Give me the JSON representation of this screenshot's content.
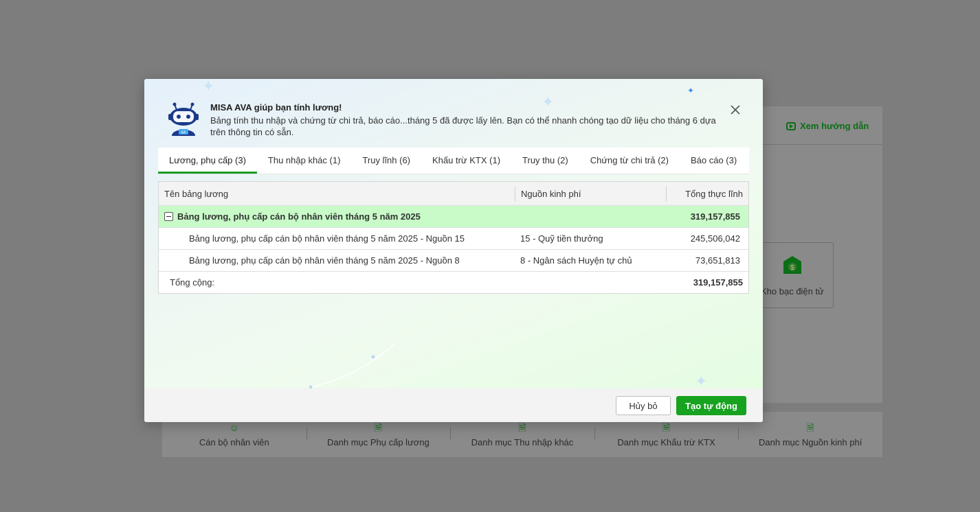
{
  "background": {
    "guide_link": "Xem hướng dẫn",
    "card_label": "Kho bạc điện tử",
    "bottom_items": [
      {
        "label": "Cán bộ nhân viên",
        "icon": "users-icon"
      },
      {
        "label": "Danh mục Phụ cấp lương",
        "icon": "allowance-doc-icon"
      },
      {
        "label": "Danh mục Thu nhập khác",
        "icon": "income-doc-icon"
      },
      {
        "label": "Danh mục Khấu trừ KTX",
        "icon": "deduction-doc-icon"
      },
      {
        "label": "Danh mục Nguồn kinh phí",
        "icon": "fund-doc-icon"
      }
    ]
  },
  "modal": {
    "title": "MISA AVA giúp bạn tính lương!",
    "description": "Bảng tính thu nhập và chứng từ chi trả, báo cáo...tháng 5 đã được lấy lên. Bạn có thể nhanh chóng tạo dữ liệu cho tháng 6 dựa trên thông tin có sẵn.",
    "tabs": [
      {
        "label": "Lương, phụ cấp (3)",
        "active": true
      },
      {
        "label": "Thu nhập khác (1)",
        "active": false
      },
      {
        "label": "Truy lĩnh (6)",
        "active": false
      },
      {
        "label": "Khấu trừ KTX (1)",
        "active": false
      },
      {
        "label": "Truy thu (2)",
        "active": false
      },
      {
        "label": "Chứng từ chi trả (2)",
        "active": false
      },
      {
        "label": "Báo cáo (3)",
        "active": false
      }
    ],
    "table": {
      "columns": [
        "Tên bảng lương",
        "Nguồn kinh phí",
        "Tổng thực lĩnh"
      ],
      "group": {
        "name": "Bảng lương, phụ cấp cán bộ nhân viên tháng 5 năm 2025",
        "total": "319,157,855"
      },
      "rows": [
        {
          "name": "Bảng lương, phụ cấp cán bộ nhân viên tháng 5 năm 2025 - Nguồn 15",
          "source": "15 - Quỹ tiền thưởng",
          "amount": "245,506,042"
        },
        {
          "name": "Bảng lương, phụ cấp cán bộ nhân viên tháng 5 năm 2025 - Nguồn 8",
          "source": "8 - Ngân sách Huyện tự chủ",
          "amount": "73,651,813"
        }
      ],
      "total_label": "Tổng cộng:",
      "total_value": "319,157,855"
    },
    "buttons": {
      "cancel": "Hủy bỏ",
      "create": "Tạo tự động"
    }
  },
  "colors": {
    "accent": "#17a21f",
    "group_row": "#c8fbc8",
    "overlay": "#7d7d7d"
  }
}
